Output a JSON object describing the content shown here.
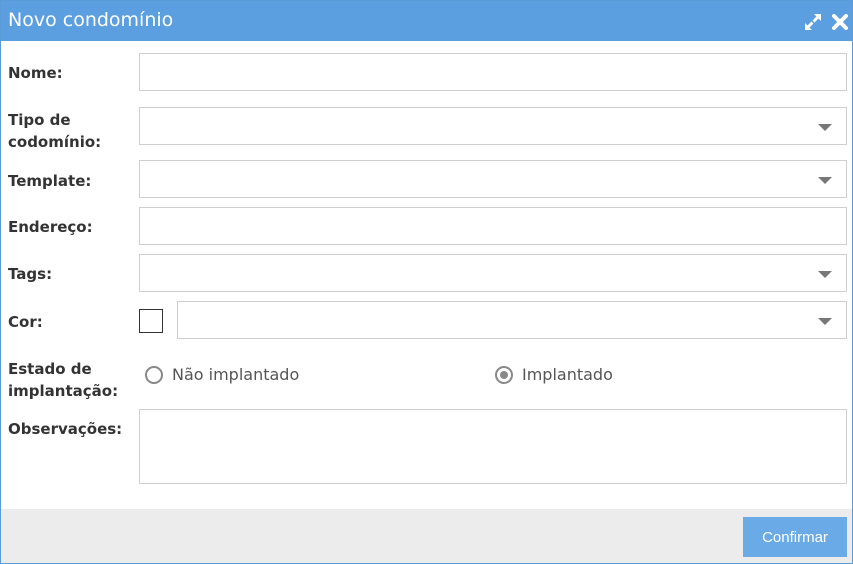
{
  "dialog": {
    "title": "Novo condomínio",
    "icons": {
      "expand": "expand-icon",
      "close": "close-icon"
    }
  },
  "form": {
    "nome_label": "Nome:",
    "tipo_label_line1": "Tipo de",
    "tipo_label_line2": "codomínio:",
    "template_label": "Template:",
    "endereco_label": "Endereço:",
    "tags_label": "Tags:",
    "cor_label": "Cor:",
    "estado_label_line1": "Estado de",
    "estado_label_line2": "implantação:",
    "estado_options": [
      "Não implantado",
      "Implantado"
    ],
    "estado_selected": "Implantado",
    "observacoes_label": "Observações:"
  },
  "footer": {
    "confirm_label": "Confirmar"
  },
  "colors": {
    "titlebar": "#5b9fe0",
    "confirm": "#6aaae6",
    "footer": "#ececec"
  }
}
